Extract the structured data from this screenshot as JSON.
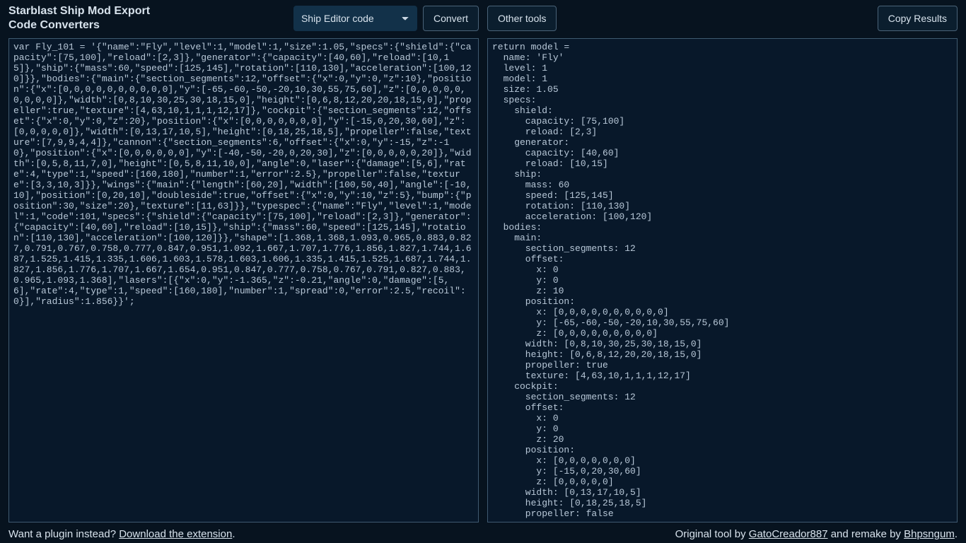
{
  "header": {
    "title_line1": "Starblast Ship Mod Export",
    "title_line2": "Code Converters",
    "dropdown_selected": "Ship Editor code",
    "dropdown_options": [
      "Ship Editor code"
    ],
    "convert_label": "Convert",
    "other_tools_label": "Other tools",
    "copy_label": "Copy Results"
  },
  "footer": {
    "plugin_prefix": "Want a plugin instead? ",
    "plugin_link": "Download the extension",
    "plugin_suffix": ".",
    "credits_prefix": "Original tool by ",
    "credits_author1": "GatoCreador887",
    "credits_mid": " and remake by ",
    "credits_author2": "Bhpsngum",
    "credits_suffix": "."
  },
  "input_code": "var Fly_101 = '{\"name\":\"Fly\",\"level\":1,\"model\":1,\"size\":1.05,\"specs\":{\"shield\":{\"capacity\":[75,100],\"reload\":[2,3]},\"generator\":{\"capacity\":[40,60],\"reload\":[10,15]},\"ship\":{\"mass\":60,\"speed\":[125,145],\"rotation\":[110,130],\"acceleration\":[100,120]}},\"bodies\":{\"main\":{\"section_segments\":12,\"offset\":{\"x\":0,\"y\":0,\"z\":10},\"position\":{\"x\":[0,0,0,0,0,0,0,0,0,0],\"y\":[-65,-60,-50,-20,10,30,55,75,60],\"z\":[0,0,0,0,0,0,0,0,0]},\"width\":[0,8,10,30,25,30,18,15,0],\"height\":[0,6,8,12,20,20,18,15,0],\"propeller\":true,\"texture\":[4,63,10,1,1,1,12,17]},\"cockpit\":{\"section_segments\":12,\"offset\":{\"x\":0,\"y\":0,\"z\":20},\"position\":{\"x\":[0,0,0,0,0,0,0],\"y\":[-15,0,20,30,60],\"z\":[0,0,0,0,0]},\"width\":[0,13,17,10,5],\"height\":[0,18,25,18,5],\"propeller\":false,\"texture\":[7,9,9,4,4]},\"cannon\":{\"section_segments\":6,\"offset\":{\"x\":0,\"y\":-15,\"z\":-10},\"position\":{\"x\":[0,0,0,0,0,0],\"y\":[-40,-50,-20,0,20,30],\"z\":[0,0,0,0,0,20]},\"width\":[0,5,8,11,7,0],\"height\":[0,5,8,11,10,0],\"angle\":0,\"laser\":{\"damage\":[5,6],\"rate\":4,\"type\":1,\"speed\":[160,180],\"number\":1,\"error\":2.5},\"propeller\":false,\"texture\":[3,3,10,3]}},\"wings\":{\"main\":{\"length\":[60,20],\"width\":[100,50,40],\"angle\":[-10,10],\"position\":[0,20,10],\"doubleside\":true,\"offset\":{\"x\":0,\"y\":10,\"z\":5},\"bump\":{\"position\":30,\"size\":20},\"texture\":[11,63]}},\"typespec\":{\"name\":\"Fly\",\"level\":1,\"model\":1,\"code\":101,\"specs\":{\"shield\":{\"capacity\":[75,100],\"reload\":[2,3]},\"generator\":{\"capacity\":[40,60],\"reload\":[10,15]},\"ship\":{\"mass\":60,\"speed\":[125,145],\"rotation\":[110,130],\"acceleration\":[100,120]}},\"shape\":[1.368,1.368,1.093,0.965,0.883,0.827,0.791,0.767,0.758,0.777,0.847,0.951,1.092,1.667,1.707,1.776,1.856,1.827,1.744,1.687,1.525,1.415,1.335,1.606,1.603,1.578,1.603,1.606,1.335,1.415,1.525,1.687,1.744,1.827,1.856,1.776,1.707,1.667,1.654,0.951,0.847,0.777,0.758,0.767,0.791,0.827,0.883,0.965,1.093,1.368],\"lasers\":[{\"x\":0,\"y\":-1.365,\"z\":-0.21,\"angle\":0,\"damage\":[5,6],\"rate\":4,\"type\":1,\"speed\":[160,180],\"number\":1,\"spread\":0,\"error\":2.5,\"recoil\":0}],\"radius\":1.856}}';",
  "output_code": "return model =\n  name: 'Fly'\n  level: 1\n  model: 1\n  size: 1.05\n  specs:\n    shield:\n      capacity: [75,100]\n      reload: [2,3]\n    generator:\n      capacity: [40,60]\n      reload: [10,15]\n    ship:\n      mass: 60\n      speed: [125,145]\n      rotation: [110,130]\n      acceleration: [100,120]\n  bodies:\n    main:\n      section_segments: 12\n      offset:\n        x: 0\n        y: 0\n        z: 10\n      position:\n        x: [0,0,0,0,0,0,0,0,0,0]\n        y: [-65,-60,-50,-20,10,30,55,75,60]\n        z: [0,0,0,0,0,0,0,0,0]\n      width: [0,8,10,30,25,30,18,15,0]\n      height: [0,6,8,12,20,20,18,15,0]\n      propeller: true\n      texture: [4,63,10,1,1,1,12,17]\n    cockpit:\n      section_segments: 12\n      offset:\n        x: 0\n        y: 0\n        z: 20\n      position:\n        x: [0,0,0,0,0,0,0]\n        y: [-15,0,20,30,60]\n        z: [0,0,0,0,0]\n      width: [0,13,17,10,5]\n      height: [0,18,25,18,5]\n      propeller: false\n"
}
